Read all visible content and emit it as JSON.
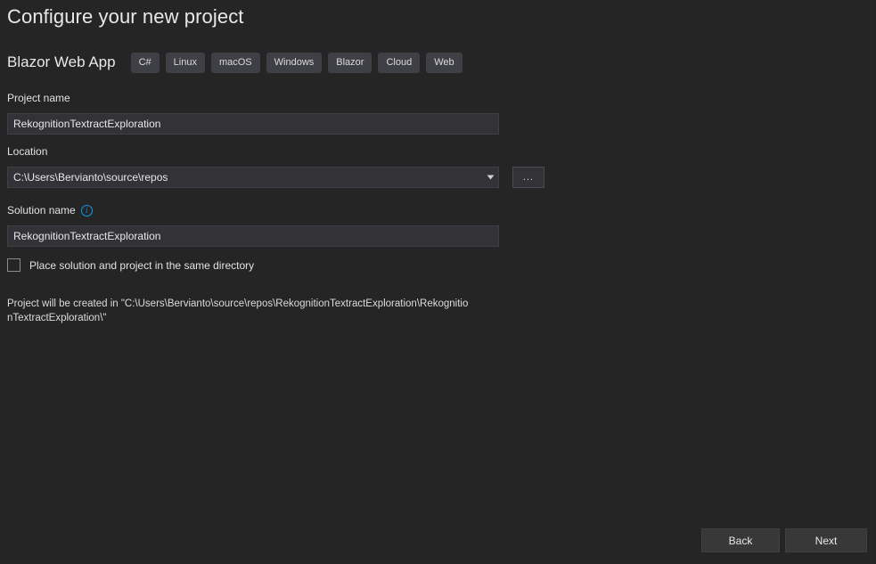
{
  "header": {
    "title": "Configure your new project",
    "template_name": "Blazor Web App",
    "tags": [
      {
        "label": "C#"
      },
      {
        "label": "Linux"
      },
      {
        "label": "macOS"
      },
      {
        "label": "Windows"
      },
      {
        "label": "Blazor"
      },
      {
        "label": "Cloud"
      },
      {
        "label": "Web"
      }
    ]
  },
  "form": {
    "project_name": {
      "label": "Project name",
      "value": "RekognitionTextractExploration",
      "placeholder": ""
    },
    "location": {
      "label": "Location",
      "value": "C:\\Users\\Bervianto\\source\\repos",
      "placeholder": "",
      "browse_label": "..."
    },
    "solution_name": {
      "label": "Solution name",
      "info_icon": "info-icon",
      "info_glyph": "i",
      "value": "RekognitionTextractExploration",
      "placeholder": ""
    },
    "same_directory": {
      "label": "Place solution and project in the same directory",
      "checked": false
    },
    "path_note": "Project will be created in \"C:\\Users\\Bervianto\\source\\repos\\RekognitionTextractExploration\\RekognitionTextractExploration\\\""
  },
  "footer": {
    "back_label": "Back",
    "next_label": "Next"
  },
  "colors": {
    "background": "#252526",
    "input_background": "#333337",
    "tag_background": "#3f3f46",
    "button_background": "#383838",
    "accent_info": "#0e9ce8",
    "text_primary": "#e8e8e8"
  }
}
